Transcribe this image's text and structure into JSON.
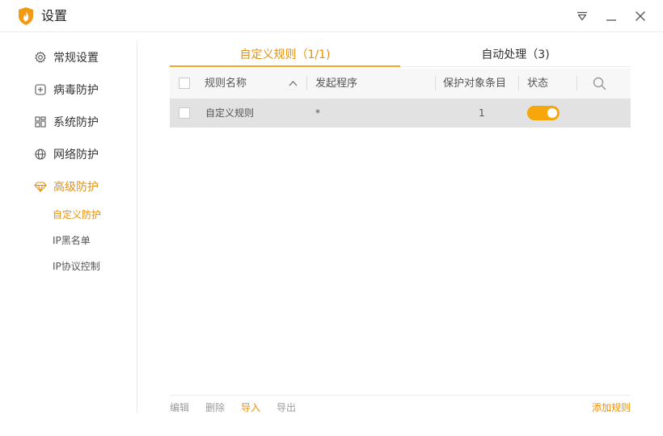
{
  "window": {
    "title": "设置"
  },
  "sidebar": {
    "items": [
      {
        "label": "常规设置",
        "icon": "gear-icon"
      },
      {
        "label": "病毒防护",
        "icon": "plus-square-icon"
      },
      {
        "label": "系统防护",
        "icon": "grid-icon"
      },
      {
        "label": "网络防护",
        "icon": "globe-icon"
      },
      {
        "label": "高级防护",
        "icon": "diamond-icon"
      }
    ],
    "sub_items": [
      {
        "label": "自定义防护"
      },
      {
        "label": "IP黑名单"
      },
      {
        "label": "IP协议控制"
      }
    ]
  },
  "tabs": [
    {
      "label": "自定义规则（1/1)"
    },
    {
      "label": "自动处理（3)"
    }
  ],
  "table": {
    "columns": [
      "规则名称",
      "发起程序",
      "保护对象条目",
      "状态"
    ],
    "rows": [
      {
        "name": "自定义规则",
        "program": "*",
        "count": "1",
        "enabled": true
      }
    ]
  },
  "footer": {
    "edit": "编辑",
    "delete": "删除",
    "import": "导入",
    "export": "导出",
    "add_rule": "添加规则"
  },
  "colors": {
    "accent": "#e8900c",
    "toggle_on": "#f7a60c",
    "selected_row": "#e2e2e2"
  }
}
